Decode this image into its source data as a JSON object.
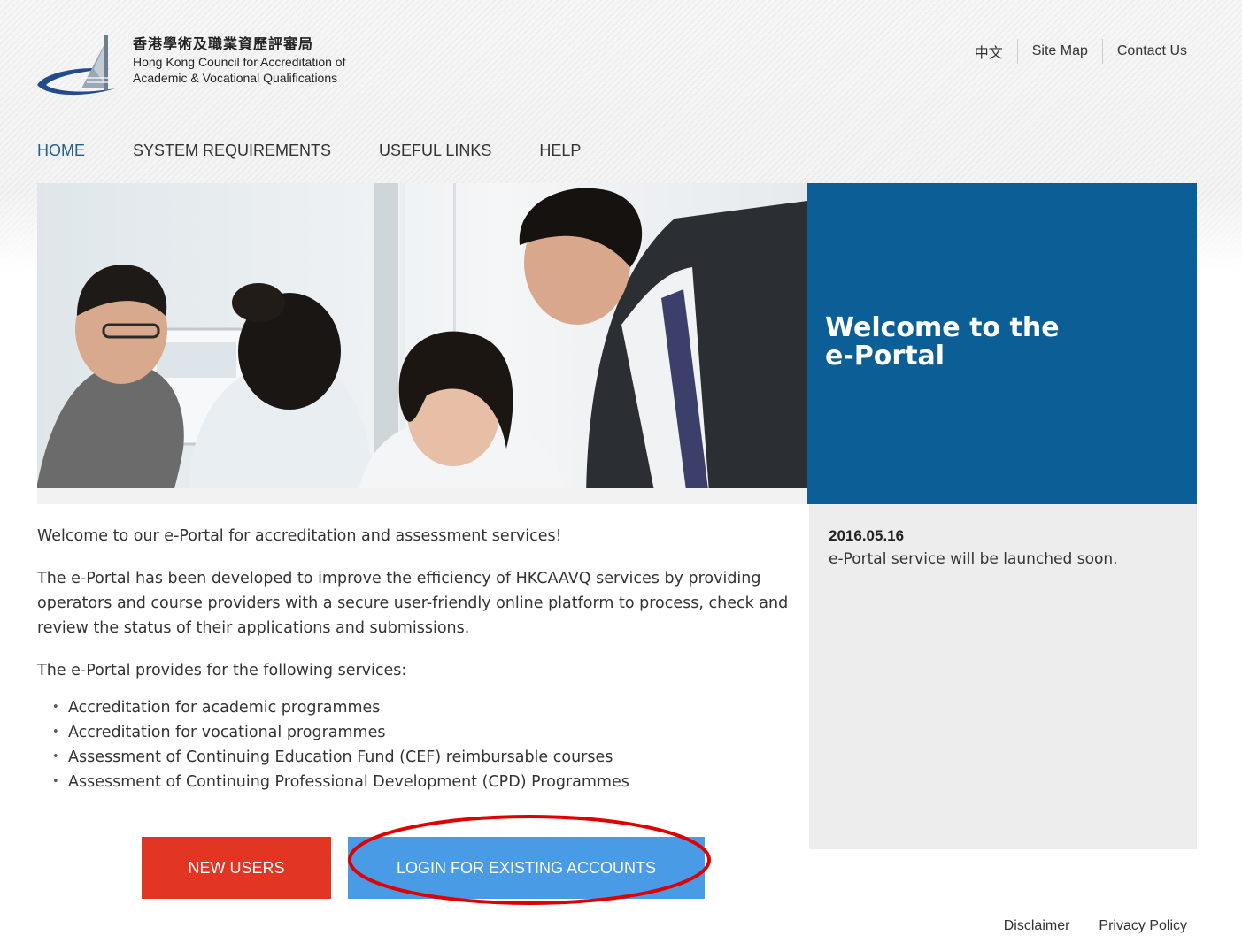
{
  "header": {
    "logo_zh": "香港學術及職業資歷評審局",
    "logo_en_line1": "Hong Kong Council for Accreditation of",
    "logo_en_line2": "Academic & Vocational Qualifications",
    "top_links": [
      "中文",
      "Site Map",
      "Contact Us"
    ]
  },
  "nav": {
    "items": [
      "HOME",
      "SYSTEM REQUIREMENTS",
      "USEFUL LINKS",
      "HELP"
    ],
    "active": "HOME"
  },
  "hero": {
    "welcome_line1": "Welcome to the",
    "welcome_line2": "e-Portal"
  },
  "main": {
    "intro": "Welcome to our e-Portal for accreditation and assessment services!",
    "description": "The e-Portal has been developed to improve the efficiency of HKCAAVQ services by providing operators and course providers with a secure user-friendly online platform to process, check and review the status of their applications and submissions.",
    "services_heading": "The e-Portal provides for the following services:",
    "services": [
      "Accreditation for academic programmes",
      "Accreditation for vocational programmes",
      "Assessment of Continuing Education Fund (CEF) reimbursable courses",
      "Assessment of Continuing Professional Development (CPD) Programmes"
    ],
    "new_users_label": "NEW USERS",
    "login_label": "LOGIN FOR EXISTING ACCOUNTS"
  },
  "news": {
    "date": "2016.05.16",
    "text": "e-Portal service will be launched soon."
  },
  "footer": {
    "links": [
      "Disclaimer",
      "Privacy Policy"
    ]
  },
  "colors": {
    "brand_blue": "#0c5f96",
    "nav_active": "#1f5f95",
    "new_users_red": "#e23524",
    "login_blue": "#4a9be5",
    "annotation_red": "#e00000",
    "news_bg": "#ededed"
  }
}
